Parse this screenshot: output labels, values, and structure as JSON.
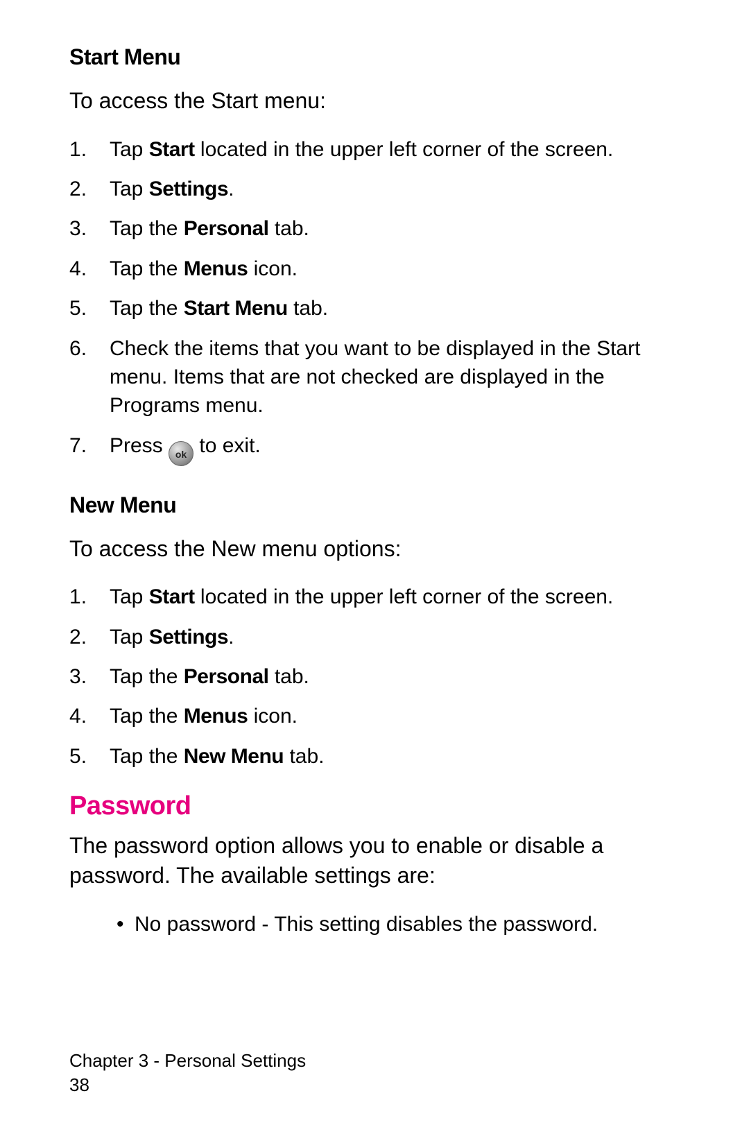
{
  "section1": {
    "heading": "Start Menu",
    "lead": "To access the Start menu:",
    "steps": {
      "s1_pre": "Tap ",
      "s1_b": "Start",
      "s1_post": " located in the upper left corner of the screen.",
      "s2_pre": "Tap ",
      "s2_b": "Settings",
      "s2_post": ".",
      "s3_pre": "Tap the ",
      "s3_b": "Personal",
      "s3_post": " tab.",
      "s4_pre": "Tap the ",
      "s4_b": "Menus",
      "s4_post": " icon.",
      "s5_pre": "Tap the ",
      "s5_b": "Start Menu",
      "s5_post": " tab.",
      "s6": "Check the items that you want to be displayed in the Start menu. Items that are not checked are displayed in the Programs menu.",
      "s7_pre": "Press ",
      "s7_icon": "ok",
      "s7_post": " to exit."
    }
  },
  "section2": {
    "heading": "New Menu",
    "lead": "To access the New menu options:",
    "steps": {
      "s1_pre": "Tap ",
      "s1_b": "Start",
      "s1_post": " located in the upper left corner of the screen.",
      "s2_pre": "Tap ",
      "s2_b": "Settings",
      "s2_post": ".",
      "s3_pre": "Tap the ",
      "s3_b": "Personal",
      "s3_post": " tab.",
      "s4_pre": "Tap the ",
      "s4_b": "Menus",
      "s4_post": " icon.",
      "s5_pre": "Tap the ",
      "s5_b": "New Menu",
      "s5_post": " tab."
    }
  },
  "section3": {
    "heading": "Password",
    "body": "The password option allows you to enable or disable a password. The available settings are:",
    "bullets": {
      "b1": "No password - This setting disables the password."
    }
  },
  "footer": {
    "chapter": "Chapter 3 - Personal Settings",
    "page": "38"
  }
}
